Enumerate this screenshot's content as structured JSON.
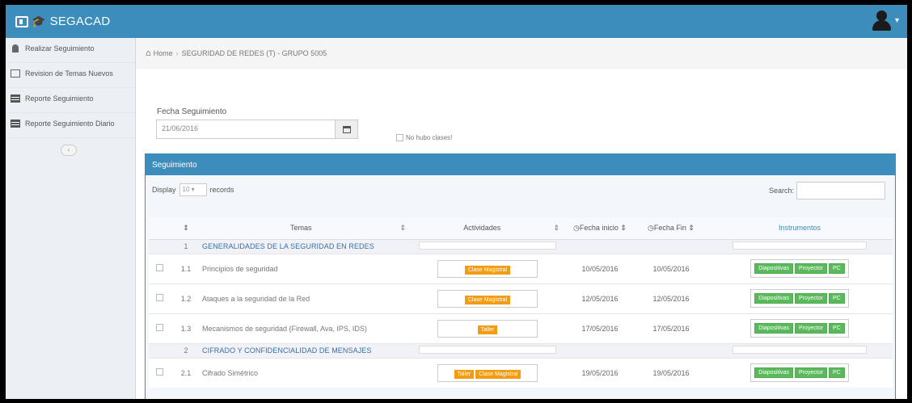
{
  "app": {
    "title": "SEGACAD"
  },
  "sidebar": {
    "items": [
      {
        "label": "Realizar Seguimiento",
        "icon": "user-icon"
      },
      {
        "label": "Revision de Temas Nuevos",
        "icon": "edit-icon"
      },
      {
        "label": "Reporte Seguimiento",
        "icon": "table-icon"
      },
      {
        "label": "Reporte Seguimiento Diario",
        "icon": "table-icon"
      }
    ],
    "collapse_label": "‹"
  },
  "breadcrumb": {
    "home": "Home",
    "current": "SEGURIDAD DE REDES (T) - GRUPO 5005"
  },
  "form": {
    "fecha_label": "Fecha Seguimiento",
    "fecha_value": "21/06/2016",
    "no_hubo_label": "No hubo clases!"
  },
  "panel": {
    "title": "Seguimiento",
    "display_label": "Display",
    "display_value": "10",
    "records_label": "records",
    "search_label": "Search:"
  },
  "table": {
    "headers": {
      "num": "",
      "temas": "Temas",
      "actividades": "Actividades",
      "fecha_inicio": "Fecha inicio",
      "fecha_fin": "Fecha Fin",
      "instrumentos": "Instrumentos"
    },
    "rows": [
      {
        "type": "group",
        "num": "1",
        "tema": "GENERALIDADES DE LA SEGURIDAD EN REDES"
      },
      {
        "type": "item",
        "num": "1.1",
        "tema": "Principios de seguridad",
        "actividades": [
          "Clase Magistral"
        ],
        "inicio": "10/05/2016",
        "fin": "10/05/2016",
        "instrumentos": [
          "Diapositivas",
          "Proyector",
          "PC"
        ]
      },
      {
        "type": "item",
        "num": "1.2",
        "tema": "Ataques a la seguridad de la Red",
        "actividades": [
          "Clase Magistral"
        ],
        "inicio": "12/05/2016",
        "fin": "12/05/2016",
        "instrumentos": [
          "Diapositivas",
          "Proyector",
          "PC"
        ]
      },
      {
        "type": "item",
        "num": "1.3",
        "tema": "Mecanismos de seguridad (Firewall, Ava, IPS, IDS)",
        "actividades": [
          "Taller"
        ],
        "inicio": "17/05/2016",
        "fin": "17/05/2016",
        "instrumentos": [
          "Diapositivas",
          "Proyector",
          "PC"
        ]
      },
      {
        "type": "group",
        "num": "2",
        "tema": "CIFRADO Y CONFIDENCIALIDAD DE MENSAJES"
      },
      {
        "type": "item",
        "num": "2.1",
        "tema": "Cifrado Simétrico",
        "actividades": [
          "Taller",
          "Clase Magistral"
        ],
        "inicio": "19/05/2016",
        "fin": "19/05/2016",
        "instrumentos": [
          "Diapositivas",
          "Proyector",
          "PC"
        ]
      }
    ]
  },
  "colors": {
    "primary": "#3c8dbc",
    "orange": "#f39c12",
    "green": "#5cb85c"
  }
}
